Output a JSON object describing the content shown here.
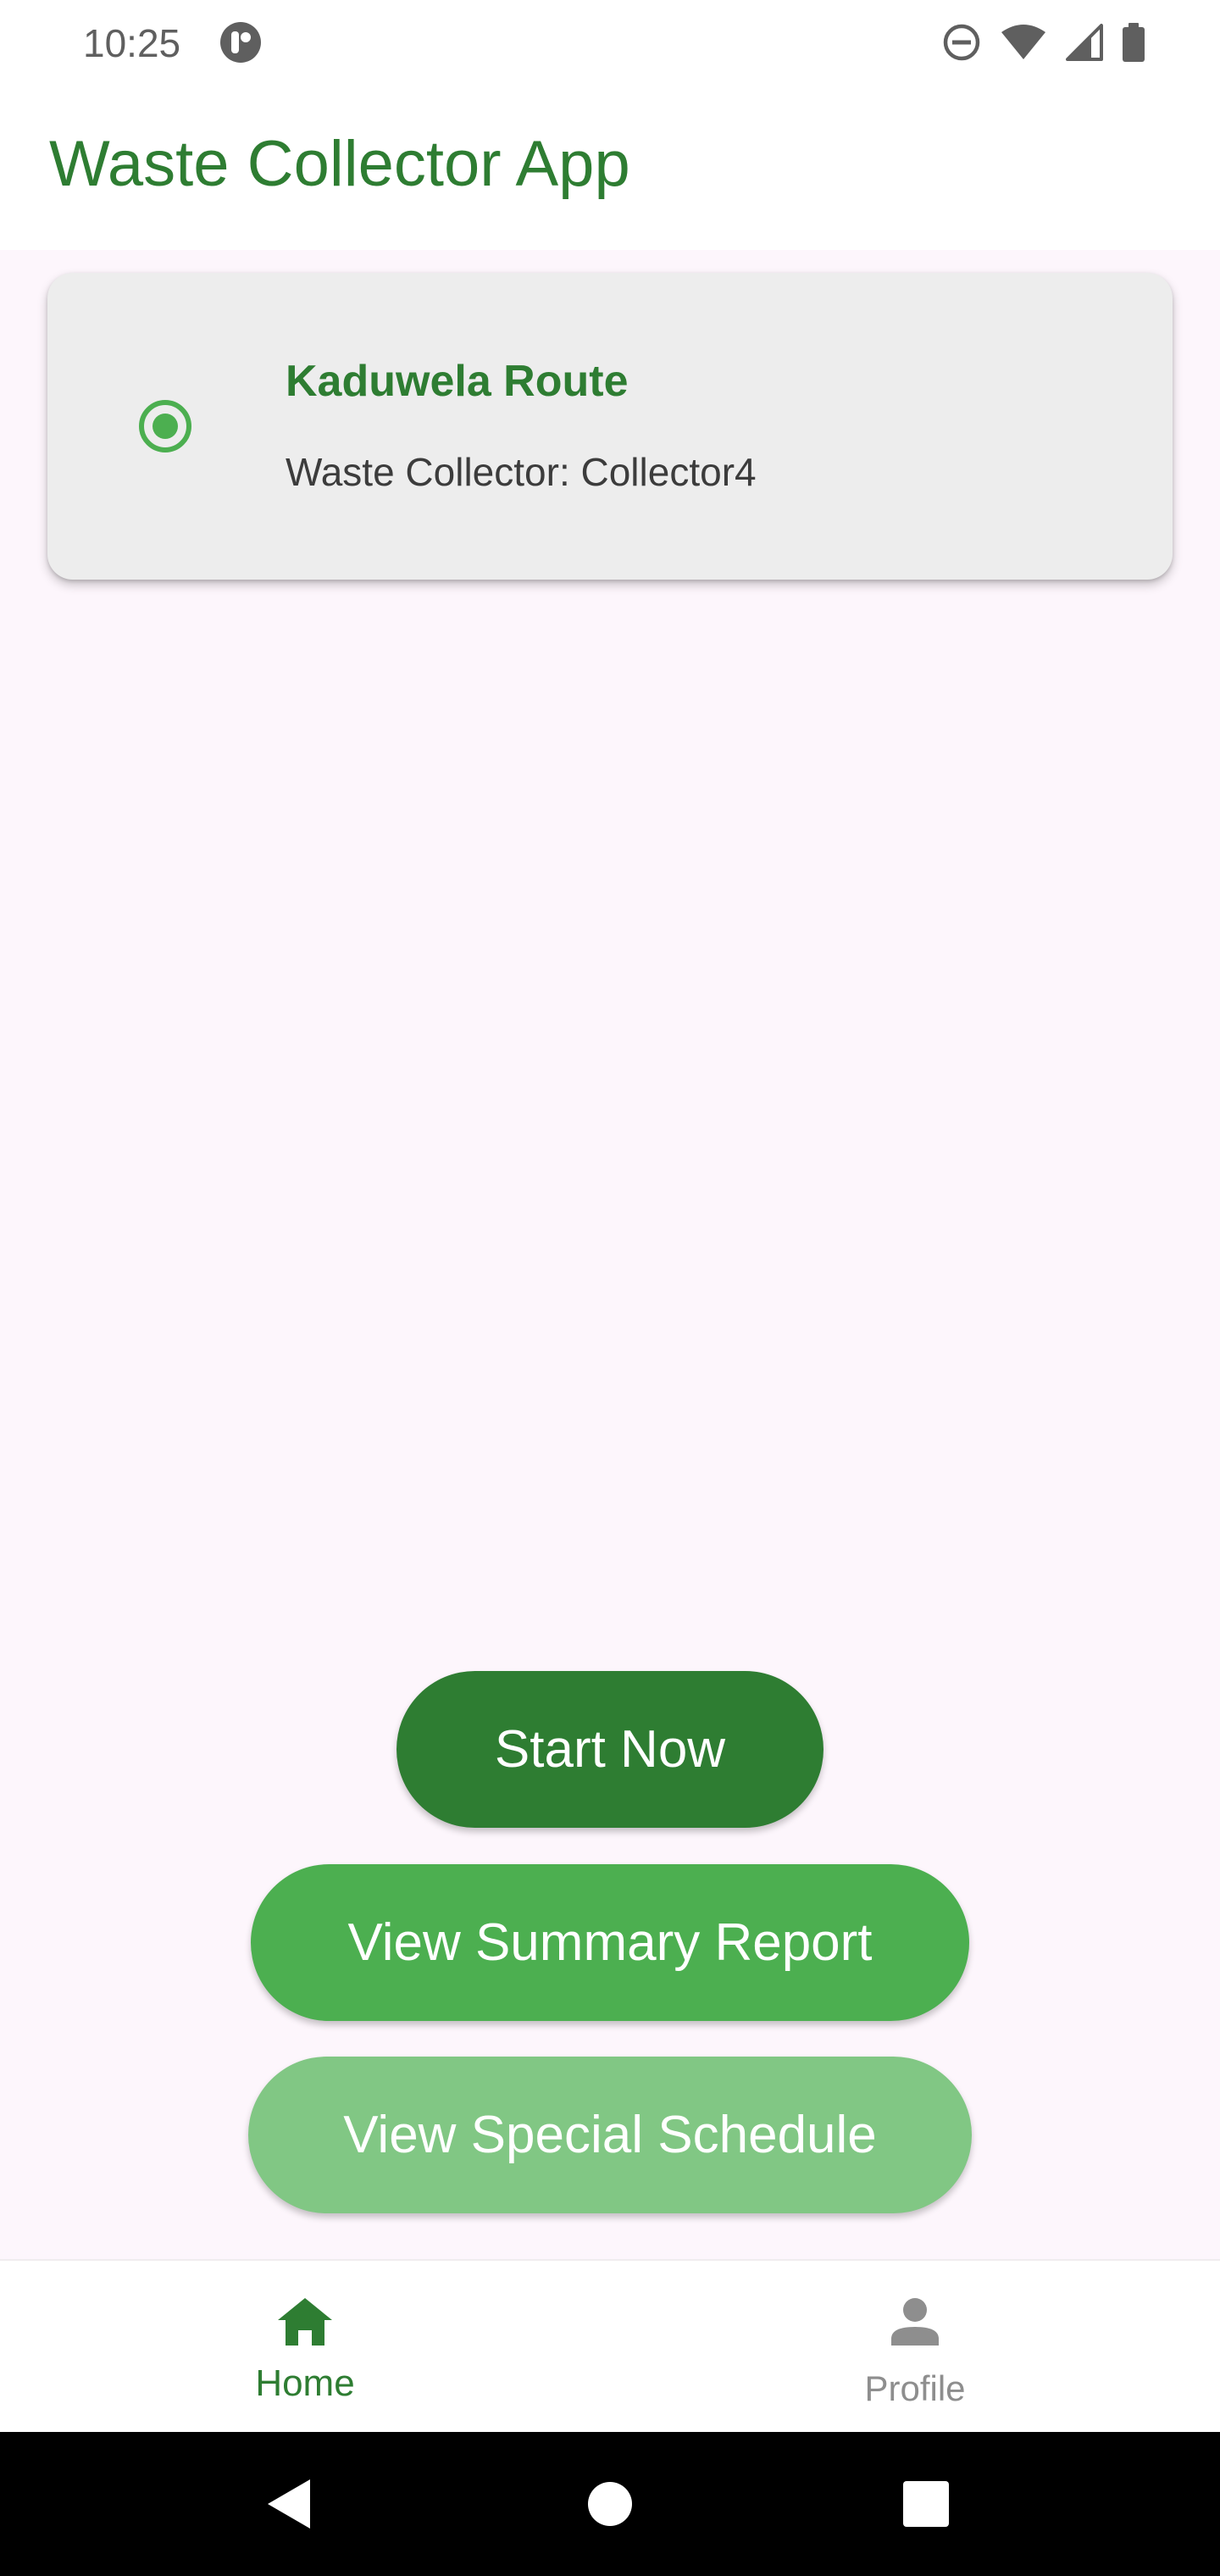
{
  "status_bar": {
    "time": "10:25",
    "icons": [
      "app-notification-icon",
      "do-not-disturb-icon",
      "wifi-icon",
      "cell-signal-icon",
      "battery-icon"
    ]
  },
  "app_bar": {
    "title": "Waste Collector App"
  },
  "route_card": {
    "selected": true,
    "title": "Kaduwela Route",
    "collector": "Waste Collector: Collector4"
  },
  "actions": {
    "start_label": "Start Now",
    "summary_label": "View Summary Report",
    "special_label": "View Special Schedule"
  },
  "bottom_nav": {
    "active": "Home",
    "items": [
      {
        "label": "Home",
        "icon": "home-icon"
      },
      {
        "label": "Profile",
        "icon": "person-icon"
      }
    ]
  },
  "system_nav": {
    "icons": [
      "back-icon",
      "home-circle-icon",
      "recents-icon"
    ]
  },
  "colors": {
    "primary_dark": "#2e7d32",
    "primary": "#4caf50",
    "primary_light": "#81c784",
    "background": "#fdf6fc",
    "card": "#ededed",
    "inactive": "#8e8e8e"
  }
}
